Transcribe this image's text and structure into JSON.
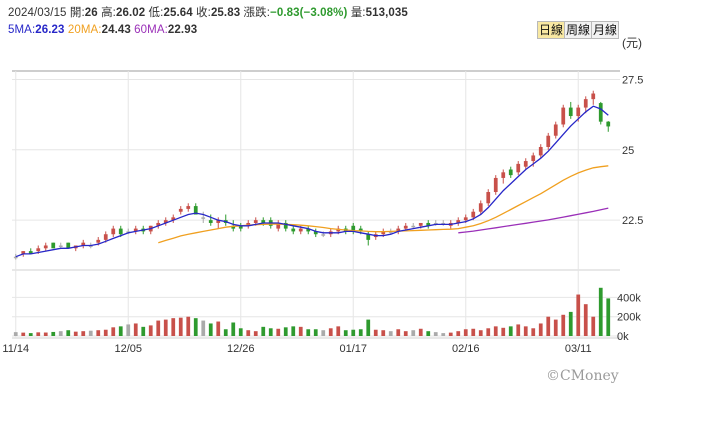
{
  "header": {
    "date": "2024/03/15",
    "open_label": "開:",
    "open": "26",
    "high_label": "高:",
    "high": "26.02",
    "low_label": "低:",
    "low": "25.64",
    "close_label": "收:",
    "close": "25.83",
    "change_label": "漲跌:",
    "change": "−0.83(−3.08%)",
    "volume_label": "量:",
    "volume": "513,035",
    "ma5_label": "5MA:",
    "ma5": "26.23",
    "ma20_label": "20MA:",
    "ma20": "24.43",
    "ma60_label": "60MA:",
    "ma60": "22.93"
  },
  "tabs": [
    "日線",
    "周線",
    "月線"
  ],
  "active_tab": "日線",
  "unit": "(元)",
  "watermark": "©CMoney",
  "colors": {
    "up": "#c8504a",
    "down": "#2e9a2e",
    "flat": "#aaaaaa",
    "ma5": "#2727c8",
    "ma20": "#f0a020",
    "ma60": "#9a2fb8",
    "grid": "#e6e6e6"
  },
  "chart_data": {
    "type": "candlestick",
    "x_tick_labels": [
      "11/14",
      "12/05",
      "12/26",
      "01/17",
      "02/16",
      "03/11"
    ],
    "x_tick_index": [
      0,
      15,
      30,
      45,
      60,
      75
    ],
    "price_axis": {
      "ticks": [
        "27.5",
        "25",
        "22.5"
      ],
      "values": [
        27.5,
        25,
        22.5
      ],
      "range": [
        20.8,
        27.8
      ]
    },
    "volume_axis": {
      "ticks": [
        "400k",
        "200k",
        "0k"
      ],
      "values": [
        400000,
        200000,
        0
      ],
      "range": [
        0,
        560000
      ]
    },
    "candles": [
      [
        21.2,
        21.3,
        21.1,
        21.2
      ],
      [
        21.3,
        21.4,
        21.2,
        21.4
      ],
      [
        21.4,
        21.5,
        21.3,
        21.3
      ],
      [
        21.4,
        21.6,
        21.3,
        21.5
      ],
      [
        21.5,
        21.7,
        21.4,
        21.6
      ],
      [
        21.7,
        21.7,
        21.5,
        21.5
      ],
      [
        21.6,
        21.7,
        21.5,
        21.6
      ],
      [
        21.7,
        21.7,
        21.5,
        21.5
      ],
      [
        21.5,
        21.6,
        21.4,
        21.6
      ],
      [
        21.6,
        21.8,
        21.5,
        21.7
      ],
      [
        21.6,
        21.7,
        21.5,
        21.6
      ],
      [
        21.7,
        21.9,
        21.6,
        21.8
      ],
      [
        21.8,
        22.1,
        21.7,
        22.0
      ],
      [
        22.0,
        22.3,
        21.9,
        22.2
      ],
      [
        22.2,
        22.3,
        21.9,
        22.0
      ],
      [
        22.1,
        22.2,
        22.0,
        22.1
      ],
      [
        22.1,
        22.3,
        22.0,
        22.2
      ],
      [
        22.2,
        22.3,
        22.0,
        22.1
      ],
      [
        22.1,
        22.3,
        22.0,
        22.3
      ],
      [
        22.3,
        22.5,
        22.2,
        22.4
      ],
      [
        22.4,
        22.6,
        22.3,
        22.5
      ],
      [
        22.5,
        22.7,
        22.4,
        22.6
      ],
      [
        22.8,
        23.0,
        22.7,
        22.9
      ],
      [
        22.9,
        23.1,
        22.8,
        23.0
      ],
      [
        23.0,
        23.1,
        22.7,
        22.7
      ],
      [
        22.6,
        22.8,
        22.4,
        22.6
      ],
      [
        22.5,
        22.7,
        22.3,
        22.4
      ],
      [
        22.4,
        22.6,
        22.2,
        22.5
      ],
      [
        22.5,
        22.7,
        22.3,
        22.4
      ],
      [
        22.3,
        22.5,
        22.1,
        22.2
      ],
      [
        22.3,
        22.4,
        22.1,
        22.2
      ],
      [
        22.3,
        22.5,
        22.2,
        22.4
      ],
      [
        22.4,
        22.6,
        22.3,
        22.5
      ],
      [
        22.5,
        22.6,
        22.3,
        22.4
      ],
      [
        22.5,
        22.6,
        22.2,
        22.3
      ],
      [
        22.2,
        22.5,
        22.1,
        22.4
      ],
      [
        22.4,
        22.5,
        22.1,
        22.2
      ],
      [
        22.2,
        22.3,
        22.0,
        22.1
      ],
      [
        22.1,
        22.3,
        22.0,
        22.2
      ],
      [
        22.2,
        22.3,
        22.0,
        22.1
      ],
      [
        22.1,
        22.2,
        21.9,
        22.0
      ],
      [
        22.0,
        22.1,
        21.9,
        22.0
      ],
      [
        22.0,
        22.2,
        21.9,
        22.1
      ],
      [
        22.1,
        22.3,
        22.0,
        22.2
      ],
      [
        22.2,
        22.3,
        22.0,
        22.1
      ],
      [
        22.3,
        22.4,
        22.0,
        22.1
      ],
      [
        22.2,
        22.3,
        22.0,
        22.1
      ],
      [
        22.0,
        22.1,
        21.6,
        21.8
      ],
      [
        21.9,
        22.1,
        21.8,
        22.0
      ],
      [
        22.0,
        22.2,
        21.9,
        22.1
      ],
      [
        22.1,
        22.2,
        22.0,
        22.1
      ],
      [
        22.1,
        22.3,
        22.0,
        22.2
      ],
      [
        22.2,
        22.4,
        22.1,
        22.3
      ],
      [
        22.3,
        22.4,
        22.2,
        22.3
      ],
      [
        22.3,
        22.4,
        22.2,
        22.4
      ],
      [
        22.4,
        22.5,
        22.2,
        22.3
      ],
      [
        22.4,
        22.5,
        22.3,
        22.4
      ],
      [
        22.4,
        22.5,
        22.3,
        22.4
      ],
      [
        22.3,
        22.5,
        22.2,
        22.4
      ],
      [
        22.4,
        22.6,
        22.3,
        22.5
      ],
      [
        22.5,
        22.7,
        22.4,
        22.6
      ],
      [
        22.6,
        22.9,
        22.5,
        22.8
      ],
      [
        22.8,
        23.2,
        22.7,
        23.1
      ],
      [
        23.1,
        23.6,
        23.0,
        23.5
      ],
      [
        23.5,
        24.1,
        23.4,
        24.0
      ],
      [
        24.0,
        24.3,
        23.8,
        24.2
      ],
      [
        24.3,
        24.4,
        24.0,
        24.1
      ],
      [
        24.2,
        24.6,
        24.1,
        24.5
      ],
      [
        24.4,
        24.7,
        24.3,
        24.6
      ],
      [
        24.6,
        24.9,
        24.4,
        24.8
      ],
      [
        24.8,
        25.2,
        24.7,
        25.1
      ],
      [
        25.1,
        25.6,
        25.0,
        25.5
      ],
      [
        25.5,
        26.0,
        25.4,
        25.9
      ],
      [
        25.9,
        26.6,
        25.8,
        26.5
      ],
      [
        26.5,
        26.7,
        26.1,
        26.2
      ],
      [
        26.2,
        26.6,
        26.0,
        26.5
      ],
      [
        26.5,
        26.9,
        26.3,
        26.8
      ],
      [
        26.8,
        27.1,
        26.6,
        27.0
      ],
      [
        26.66,
        26.7,
        25.9,
        26.0
      ],
      [
        26.0,
        26.02,
        25.64,
        25.83
      ]
    ],
    "ma5": [
      21.2,
      21.3,
      21.3,
      21.35,
      21.4,
      21.45,
      21.5,
      21.5,
      21.55,
      21.6,
      21.6,
      21.65,
      21.75,
      21.85,
      21.95,
      22.05,
      22.1,
      22.15,
      22.2,
      22.3,
      22.4,
      22.5,
      22.6,
      22.7,
      22.75,
      22.7,
      22.6,
      22.5,
      22.45,
      22.35,
      22.3,
      22.3,
      22.35,
      22.4,
      22.4,
      22.4,
      22.35,
      22.3,
      22.25,
      22.2,
      22.1,
      22.05,
      22.05,
      22.05,
      22.1,
      22.1,
      22.05,
      22.0,
      21.95,
      21.95,
      22.0,
      22.1,
      22.15,
      22.2,
      22.25,
      22.3,
      22.35,
      22.35,
      22.35,
      22.4,
      22.45,
      22.55,
      22.7,
      22.95,
      23.25,
      23.55,
      23.8,
      24.05,
      24.3,
      24.5,
      24.7,
      24.95,
      25.25,
      25.55,
      25.85,
      26.1,
      26.35,
      26.55,
      26.45,
      26.23
    ],
    "ma20": [
      null,
      null,
      null,
      null,
      null,
      null,
      null,
      null,
      null,
      null,
      null,
      null,
      null,
      null,
      null,
      null,
      null,
      null,
      null,
      21.7,
      21.78,
      21.86,
      21.94,
      22.0,
      22.05,
      22.1,
      22.15,
      22.2,
      22.25,
      22.28,
      22.3,
      22.32,
      22.34,
      22.35,
      22.36,
      22.36,
      22.35,
      22.34,
      22.32,
      22.3,
      22.27,
      22.24,
      22.2,
      22.17,
      22.15,
      22.13,
      22.12,
      22.1,
      22.09,
      22.09,
      22.1,
      22.11,
      22.12,
      22.13,
      22.14,
      22.15,
      22.16,
      22.17,
      22.18,
      22.2,
      22.25,
      22.3,
      22.38,
      22.48,
      22.6,
      22.74,
      22.88,
      23.02,
      23.16,
      23.3,
      23.44,
      23.6,
      23.76,
      23.92,
      24.06,
      24.18,
      24.28,
      24.36,
      24.4,
      24.43
    ],
    "ma60": [
      null,
      null,
      null,
      null,
      null,
      null,
      null,
      null,
      null,
      null,
      null,
      null,
      null,
      null,
      null,
      null,
      null,
      null,
      null,
      null,
      null,
      null,
      null,
      null,
      null,
      null,
      null,
      null,
      null,
      null,
      null,
      null,
      null,
      null,
      null,
      null,
      null,
      null,
      null,
      null,
      null,
      null,
      null,
      null,
      null,
      null,
      null,
      null,
      null,
      null,
      null,
      null,
      null,
      null,
      null,
      null,
      null,
      null,
      null,
      22.05,
      22.08,
      22.11,
      22.15,
      22.19,
      22.23,
      22.27,
      22.31,
      22.35,
      22.39,
      22.43,
      22.47,
      22.51,
      22.56,
      22.61,
      22.66,
      22.71,
      22.76,
      22.81,
      22.87,
      22.93
    ],
    "volumes": [
      40000,
      35000,
      30000,
      38000,
      36000,
      42000,
      50000,
      60000,
      45000,
      50000,
      55000,
      60000,
      65000,
      90000,
      100000,
      120000,
      130000,
      95000,
      110000,
      160000,
      170000,
      185000,
      190000,
      200000,
      185000,
      160000,
      130000,
      150000,
      70000,
      140000,
      80000,
      60000,
      50000,
      95000,
      80000,
      75000,
      90000,
      100000,
      95000,
      70000,
      70000,
      60000,
      80000,
      100000,
      60000,
      65000,
      70000,
      170000,
      65000,
      60000,
      50000,
      70000,
      50000,
      60000,
      75000,
      50000,
      40000,
      30000,
      35000,
      50000,
      70000,
      75000,
      60000,
      80000,
      100000,
      85000,
      100000,
      120000,
      100000,
      80000,
      130000,
      200000,
      170000,
      220000,
      250000,
      430000,
      330000,
      200000,
      500000,
      390000
    ]
  }
}
